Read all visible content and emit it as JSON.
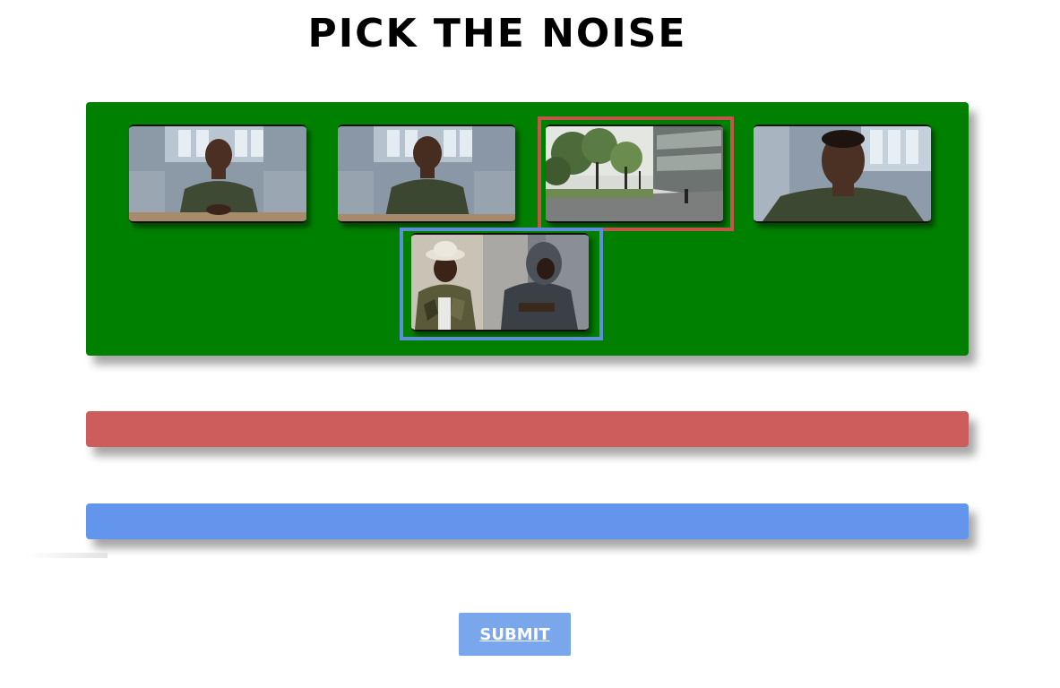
{
  "page": {
    "title": "PICK THE NOISE"
  },
  "pool": {
    "thumbnails": [
      {
        "scene": "man-seated-at-table-hands-clasped",
        "selected": null
      },
      {
        "scene": "man-seated-at-table-looking-forward",
        "selected": null
      },
      {
        "scene": "tree-lined-walkway-beside-building",
        "selected": "red"
      },
      {
        "scene": "man-close-up-looking-down",
        "selected": null
      },
      {
        "scene": "woman-in-bucket-hat-with-hooded-person",
        "selected": "blue"
      }
    ]
  },
  "bins": [
    {
      "color": "#cd5c5c"
    },
    {
      "color": "#6495ed"
    }
  ],
  "submit": {
    "label": "SUBMIT"
  },
  "colors": {
    "pool_background": "#008000",
    "red_bin": "#cd5c5c",
    "blue_bin": "#6495ed",
    "red_selection": "#c0574a",
    "blue_selection": "#5b8fd6",
    "submit_background": "#7aa6ec"
  }
}
